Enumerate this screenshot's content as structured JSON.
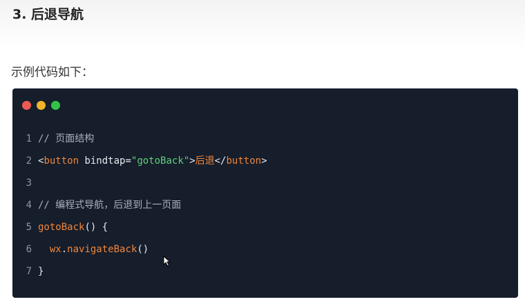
{
  "heading": "3. 后退导航",
  "intro": "示例代码如下：",
  "code": {
    "line_numbers": [
      "1",
      "2",
      "3",
      "4",
      "5",
      "6",
      "7"
    ],
    "line1_comment": "// 页面结构",
    "line2": {
      "open_lt": "<",
      "open_tag": "button",
      "attr": " bindtap",
      "eq": "=",
      "value": "\"gotoBack\"",
      "gt": ">",
      "text": "后退",
      "close_lt": "</",
      "close_tag": "button",
      "close_gt": ">"
    },
    "line4_comment": "// 编程式导航，后退到上一页面",
    "line5": {
      "fn": "gotoBack",
      "rest": "() {"
    },
    "line6": {
      "indent": "  ",
      "obj": "wx",
      "dot": ".",
      "method": "navigateBack",
      "call": "()"
    },
    "line7": "}"
  },
  "colors": {
    "code_background": "#161d2b",
    "dot_red": "#ee5a52",
    "dot_yellow": "#f0b429",
    "dot_green": "#33c148",
    "keyword_orange": "#f0873c",
    "string_green": "#5fd17a"
  }
}
